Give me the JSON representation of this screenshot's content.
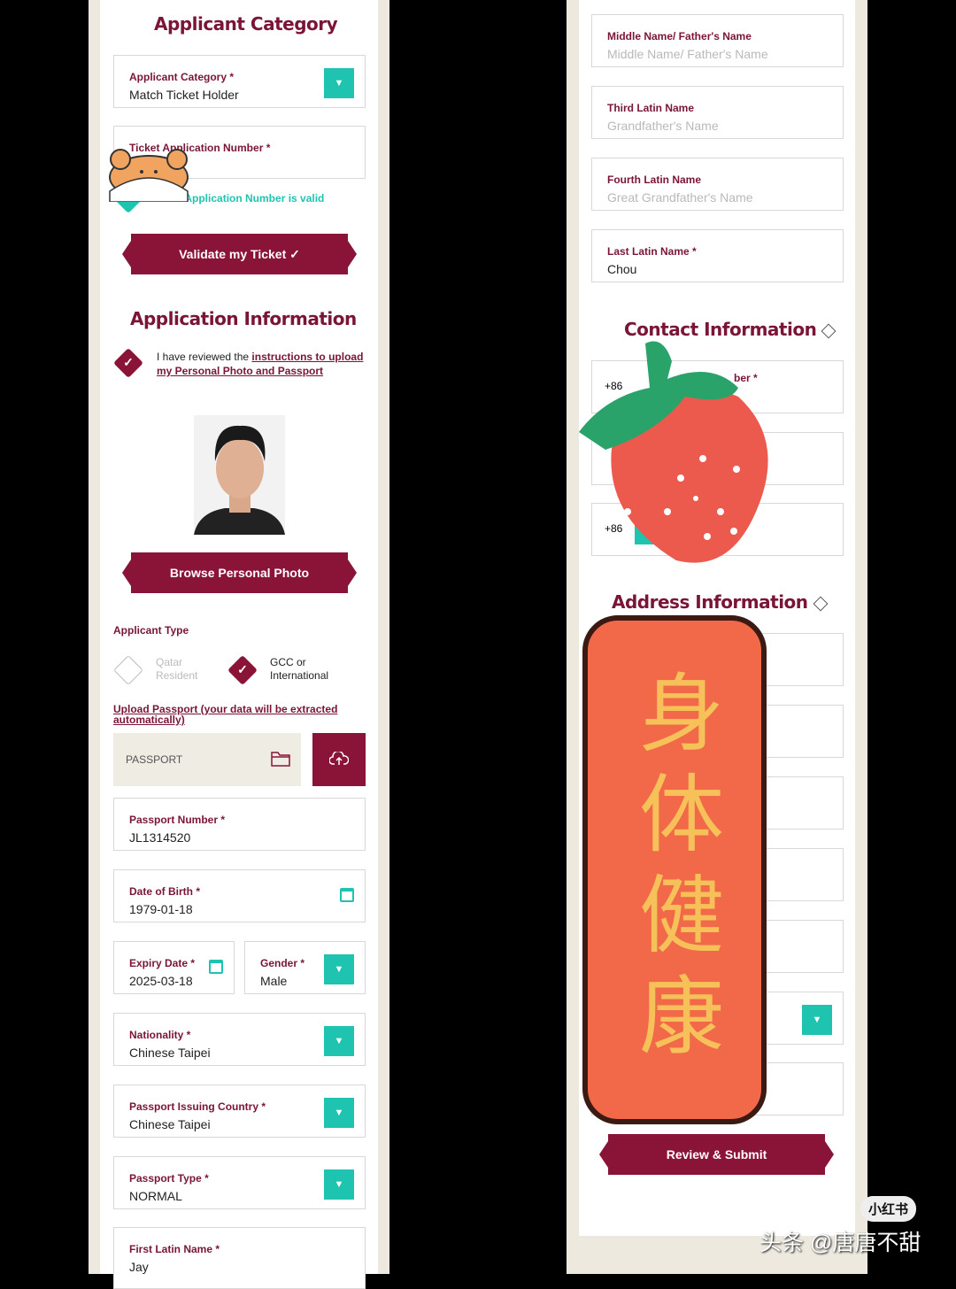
{
  "left": {
    "applicant_category_title": "Applicant Category",
    "applicant_category": {
      "label": "Applicant Category *",
      "value": "Match Ticket Holder"
    },
    "ticket_number": {
      "label": "Ticket Application Number *",
      "value": "",
      "valid_msg": "Ticket Application Number is valid"
    },
    "validate_button": "Validate my Ticket ✓",
    "application_info_title": "Application Information",
    "review_text": "I have reviewed the ",
    "review_link": "instructions to upload my Personal Photo and Passport",
    "browse_photo_button": "Browse Personal Photo",
    "applicant_type_label": "Applicant Type",
    "type_options": [
      {
        "label": "Qatar Resident",
        "selected": false
      },
      {
        "label": "GCC or International",
        "selected": true
      }
    ],
    "upload_link": "Upload Passport (your data will be extracted automatically)",
    "passport_file_placeholder": "PASSPORT",
    "passport_number": {
      "label": "Passport Number *",
      "value": "JL1314520"
    },
    "dob": {
      "label": "Date of Birth *",
      "value": "1979-01-18"
    },
    "expiry": {
      "label": "Expiry Date *",
      "value": "2025-03-18"
    },
    "gender": {
      "label": "Gender *",
      "value": "Male"
    },
    "nationality": {
      "label": "Nationality *",
      "value": "Chinese Taipei"
    },
    "issuing_country": {
      "label": "Passport Issuing Country *",
      "value": "Chinese Taipei"
    },
    "passport_type": {
      "label": "Passport Type *",
      "value": "NORMAL"
    },
    "first_name": {
      "label": "First Latin Name *",
      "value": "Jay"
    }
  },
  "right": {
    "middle_name": {
      "label": "Middle Name/ Father's Name",
      "placeholder": "Middle Name/ Father's Name"
    },
    "third_name": {
      "label": "Third Latin Name",
      "placeholder": "Grandfather's Name"
    },
    "fourth_name": {
      "label": "Fourth Latin Name",
      "placeholder": "Great Grandfather's Name"
    },
    "last_name": {
      "label": "Last Latin Name *",
      "value": "Chou"
    },
    "contact_title": "Contact Information",
    "phone_label_partial": "ber *",
    "phone_code": "+86",
    "phone_code_2": "+86",
    "address_title": "Address Information",
    "submit_button": "Review & Submit"
  },
  "stickers": {
    "banner_text": "身体健康"
  },
  "watermarks": {
    "xhs": "小红书",
    "toutiao": "头条 @唐唐不甜"
  },
  "colors": {
    "brand": "#8a1438",
    "accent": "#1fc4b0"
  }
}
